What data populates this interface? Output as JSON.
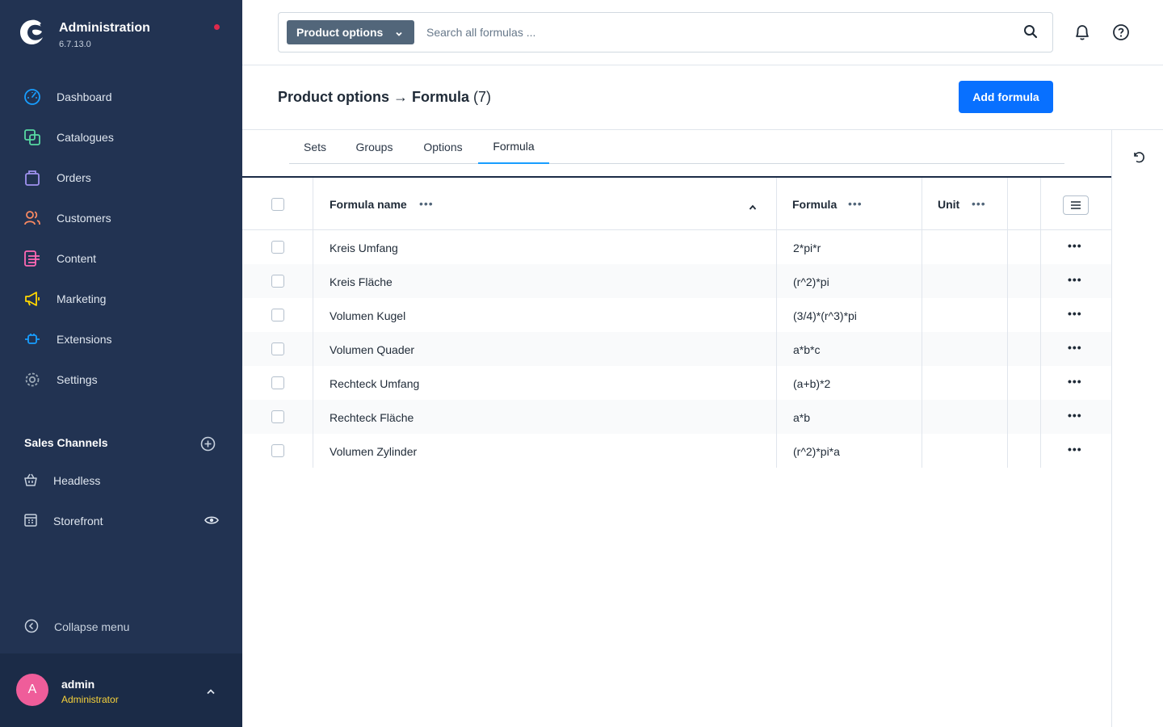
{
  "brand": {
    "title": "Administration",
    "version": "6.7.13.0"
  },
  "nav": [
    {
      "label": "Dashboard",
      "color": "#189eff"
    },
    {
      "label": "Catalogues",
      "color": "#57d9a3"
    },
    {
      "label": "Orders",
      "color": "#a092f0"
    },
    {
      "label": "Customers",
      "color": "#f88962"
    },
    {
      "label": "Content",
      "color": "#ff68b4"
    },
    {
      "label": "Marketing",
      "color": "#ffd700"
    },
    {
      "label": "Extensions",
      "color": "#189eff"
    },
    {
      "label": "Settings",
      "color": "#9aa8b5"
    }
  ],
  "sales_channels": {
    "title": "Sales Channels",
    "items": [
      {
        "label": "Headless"
      },
      {
        "label": "Storefront"
      }
    ]
  },
  "collapse_label": "Collapse menu",
  "user": {
    "initial": "A",
    "name": "admin",
    "role": "Administrator"
  },
  "search": {
    "type_label": "Product options",
    "placeholder": "Search all formulas ..."
  },
  "page": {
    "title": "Product options → Formula",
    "count": "(7)",
    "add_label": "Add formula"
  },
  "tabs": [
    {
      "label": "Sets",
      "active": false
    },
    {
      "label": "Groups",
      "active": false
    },
    {
      "label": "Options",
      "active": false
    },
    {
      "label": "Formula",
      "active": true
    }
  ],
  "grid": {
    "columns": {
      "name": "Formula name",
      "formula": "Formula",
      "unit": "Unit"
    },
    "rows": [
      {
        "name": "Kreis Umfang",
        "formula": "2*pi*r",
        "unit": ""
      },
      {
        "name": "Kreis Fläche",
        "formula": "(r^2)*pi",
        "unit": ""
      },
      {
        "name": "Volumen Kugel",
        "formula": "(3/4)*(r^3)*pi",
        "unit": ""
      },
      {
        "name": "Volumen Quader",
        "formula": "a*b*c",
        "unit": ""
      },
      {
        "name": "Rechteck Umfang",
        "formula": "(a+b)*2",
        "unit": ""
      },
      {
        "name": "Rechteck Fläche",
        "formula": "a*b",
        "unit": ""
      },
      {
        "name": "Volumen Zylinder",
        "formula": "(r^2)*pi*a",
        "unit": ""
      }
    ]
  },
  "colors": {
    "sidebar": "#223352",
    "accent": "#0870ff",
    "tab_active": "#189eff",
    "notification_dot": "#de294c"
  }
}
